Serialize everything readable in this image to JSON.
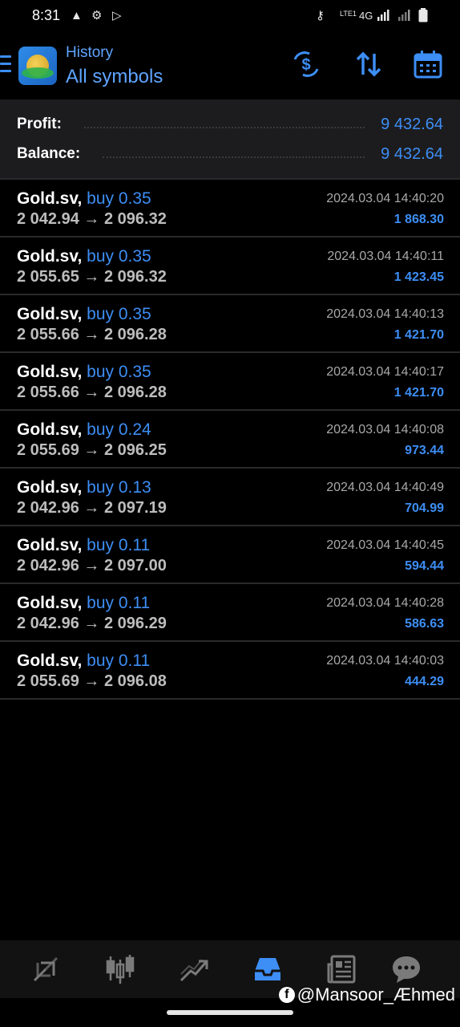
{
  "status_bar": {
    "time": "8:31",
    "network": "4G",
    "volte": "LTE1"
  },
  "header": {
    "title": "History",
    "subtitle": "All symbols",
    "accent": "#3d8ef5"
  },
  "summary": {
    "profit_label": "Profit:",
    "profit_value": "9 432.64",
    "balance_label": "Balance:",
    "balance_value": "9 432.64"
  },
  "deals": [
    {
      "symbol": "Gold.sv,",
      "side": "buy 0.35",
      "open": "2 042.94",
      "arrow": "→",
      "close": "2 096.32",
      "time": "2024.03.04 14:40:20",
      "profit": "1 868.30"
    },
    {
      "symbol": "Gold.sv,",
      "side": "buy 0.35",
      "open": "2 055.65",
      "arrow": "→",
      "close": "2 096.32",
      "time": "2024.03.04 14:40:11",
      "profit": "1 423.45"
    },
    {
      "symbol": "Gold.sv,",
      "side": "buy 0.35",
      "open": "2 055.66",
      "arrow": "→",
      "close": "2 096.28",
      "time": "2024.03.04 14:40:13",
      "profit": "1 421.70"
    },
    {
      "symbol": "Gold.sv,",
      "side": "buy 0.35",
      "open": "2 055.66",
      "arrow": "→",
      "close": "2 096.28",
      "time": "2024.03.04 14:40:17",
      "profit": "1 421.70"
    },
    {
      "symbol": "Gold.sv,",
      "side": "buy 0.24",
      "open": "2 055.69",
      "arrow": "→",
      "close": "2 096.25",
      "time": "2024.03.04 14:40:08",
      "profit": "973.44"
    },
    {
      "symbol": "Gold.sv,",
      "side": "buy 0.13",
      "open": "2 042.96",
      "arrow": "→",
      "close": "2 097.19",
      "time": "2024.03.04 14:40:49",
      "profit": "704.99"
    },
    {
      "symbol": "Gold.sv,",
      "side": "buy 0.11",
      "open": "2 042.96",
      "arrow": "→",
      "close": "2 097.00",
      "time": "2024.03.04 14:40:45",
      "profit": "594.44"
    },
    {
      "symbol": "Gold.sv,",
      "side": "buy 0.11",
      "open": "2 042.96",
      "arrow": "→",
      "close": "2 096.29",
      "time": "2024.03.04 14:40:28",
      "profit": "586.63"
    },
    {
      "symbol": "Gold.sv,",
      "side": "buy 0.11",
      "open": "2 055.69",
      "arrow": "→",
      "close": "2 096.08",
      "time": "2024.03.04 14:40:03",
      "profit": "444.29"
    }
  ],
  "bottom_nav": {
    "items": [
      "quotes-icon",
      "chart-icon",
      "trade-icon",
      "history-icon",
      "news-icon",
      "messages-icon"
    ],
    "active": "history-icon"
  },
  "watermark": {
    "fb_letter": "f",
    "text": "@Mansoor_Æhmed"
  }
}
